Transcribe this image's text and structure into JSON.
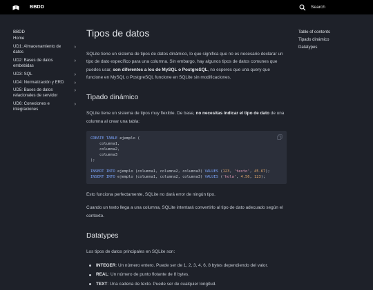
{
  "header": {
    "title": "BBDD",
    "logo_icon": "book-icon",
    "search_label": "Search"
  },
  "sidebar": {
    "title": "BBDD",
    "items": [
      {
        "label": "Home",
        "chevron": false
      },
      {
        "label": "UD1: Almacenamiento de datos",
        "chevron": true
      },
      {
        "label": "UD2: Bases de datos embebidas",
        "chevron": true
      },
      {
        "label": "UD3: SQL",
        "chevron": true
      },
      {
        "label": "UD4: Normalización y ERD",
        "chevron": true
      },
      {
        "label": "UD5: Bases de datos relacionales de servidor",
        "chevron": true
      },
      {
        "label": "UD6: Conexiones e integraciones",
        "chevron": true
      }
    ]
  },
  "toc": {
    "title": "Table of contents",
    "items": [
      "Tipado dinámico",
      "Datatypes"
    ]
  },
  "main": {
    "title": "Tipos de datos",
    "intro_1": "SQLite tiene un sistema de tipos de datos dinámico, lo que significa que no es necesario declarar un tipo de dato específico para una columna. Sin embargo, hay algunos tipos de datos comunes que puedes usar, ",
    "intro_bold": "son diferentes a los de MySQL o PostgreSQL",
    "intro_2": ", no esperes que una query que funcione en MySQL o PostgreSQL funcione en SQLite sin modificaciones.",
    "section1_title": "Tipado dinámico",
    "s1_p1_a": "SQLite tiene un sistema de tipos muy flexible. De base, ",
    "s1_p1_bold": "no necesitas indicar el tipo de dato",
    "s1_p1_b": " de una columna al crear una tabla:",
    "code": {
      "create": "CREATE TABLE",
      "table_open": " ejemplo (",
      "col1": "    columna1,",
      "col2": "    columna2,",
      "col3": "    columna3",
      "close": ");",
      "insert_kw": "INSERT INTO",
      "insert_cols": " ejemplo (columna1, columna2, columna3) ",
      "values_kw": "VALUES",
      "r1_open": " (",
      "r1_v1": "123",
      "r1_s": "'texto'",
      "r1_v3": "45.67",
      "r2_v1": "'hola'",
      "r2_v2": "4.56",
      "r2_v3": "123"
    },
    "after_code": "Esto funciona perfectamente, SQLite no dará error de ningún tipo.",
    "s1_p3": "Cuando un texto llega a una columna, SQLite intentará convertirlo al tipo de dato adecuado según el contexto.",
    "section2_title": "Datatypes",
    "s2_intro": "Los tipos de datos principales en SQLite son:",
    "types": [
      {
        "name": "INTEGER",
        "desc": ": Un número entero. Puede ser de 1, 2, 3, 4, 6, 8 bytes dependiendo del valor."
      },
      {
        "name": "REAL",
        "desc": ": Un número de punto flotante de 8 bytes."
      },
      {
        "name": "TEXT",
        "desc": ": Una cadena de texto. Puede ser de cualquier longitud."
      }
    ]
  }
}
